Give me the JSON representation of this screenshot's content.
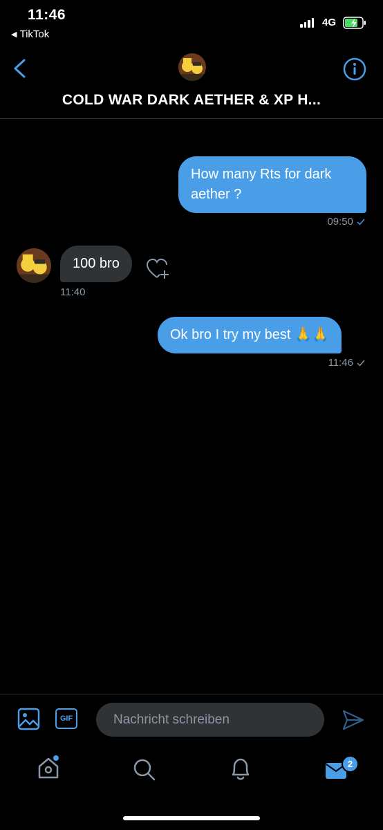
{
  "status_bar": {
    "time": "11:46",
    "back_app": "TikTok",
    "network": "4G"
  },
  "header": {
    "title": "COLD WAR DARK AETHER & XP H..."
  },
  "messages": [
    {
      "direction": "outgoing",
      "text": "How many Rts for dark aether ?",
      "time": "09:50"
    },
    {
      "direction": "incoming",
      "text": "100 bro",
      "time": "11:40"
    },
    {
      "direction": "outgoing",
      "text": "Ok bro I try my best 🙏🙏",
      "time": "11:46"
    }
  ],
  "composer": {
    "placeholder": "Nachricht schreiben",
    "gif_label": "GIF"
  },
  "tab_bar": {
    "messages_badge": "2"
  },
  "colors": {
    "accent": "#4a9ee8",
    "incoming_bubble": "#2f3336",
    "background": "#000000"
  }
}
